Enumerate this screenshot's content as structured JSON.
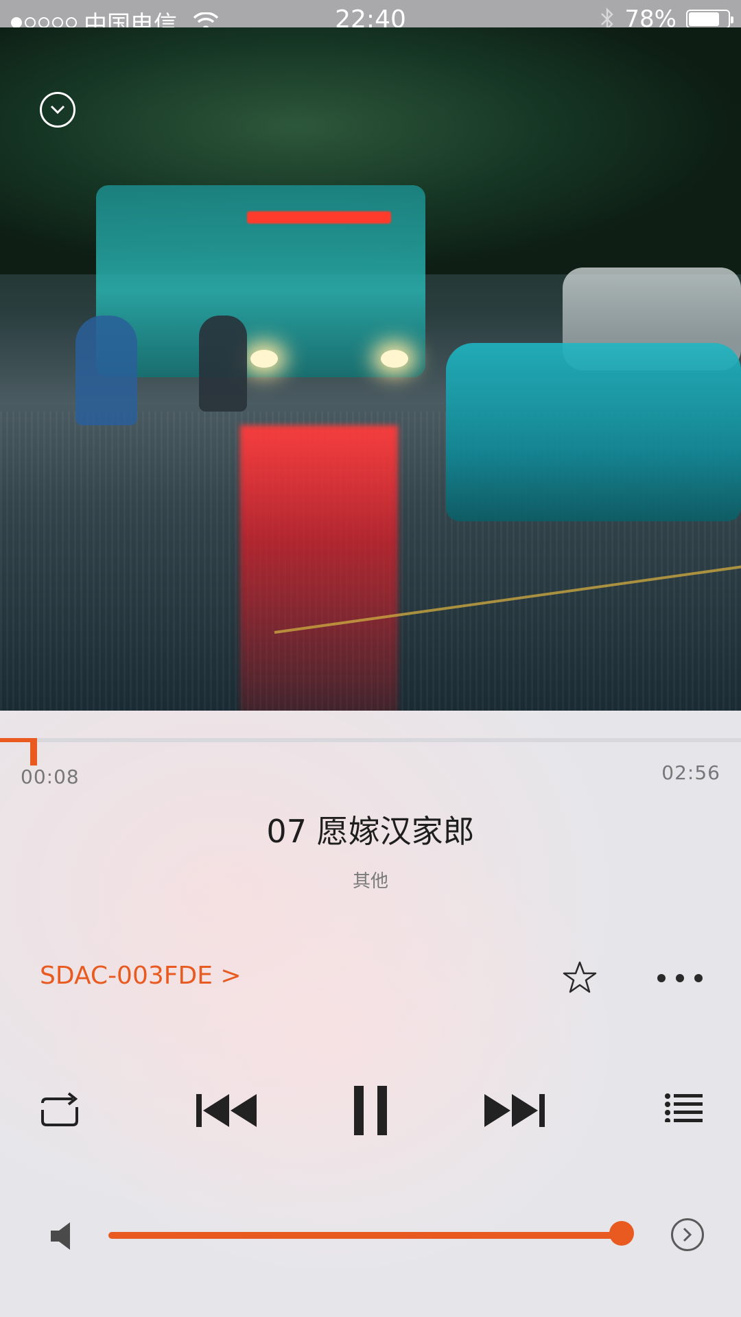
{
  "status_bar": {
    "signal_dots_filled": 1,
    "signal_dots_total": 5,
    "carrier": "中国电信",
    "time": "22:40",
    "battery_percent": "78%",
    "battery_level": 0.78
  },
  "player": {
    "progress": {
      "current_time": "00:08",
      "total_time": "02:56",
      "fraction": 0.045
    },
    "track": {
      "title": "07 愿嫁汉家郎",
      "artist": "其他"
    },
    "device_link": "SDAC-003FDE >",
    "volume_level": 0.95
  },
  "icons": {
    "collapse": "chevron-down-circle-icon",
    "favorite": "star-outline-icon",
    "more": "more-dots-icon",
    "repeat": "repeat-icon",
    "previous": "skip-previous-icon",
    "pause": "pause-icon",
    "next": "skip-next-icon",
    "playlist": "playlist-icon",
    "volume": "speaker-icon",
    "output": "chevron-right-circle-icon"
  },
  "colors": {
    "accent": "#e85a1f",
    "status_bar_bg": "#a9a9ab",
    "text_primary": "#1e1e1e",
    "text_secondary": "#7a7a7a"
  }
}
